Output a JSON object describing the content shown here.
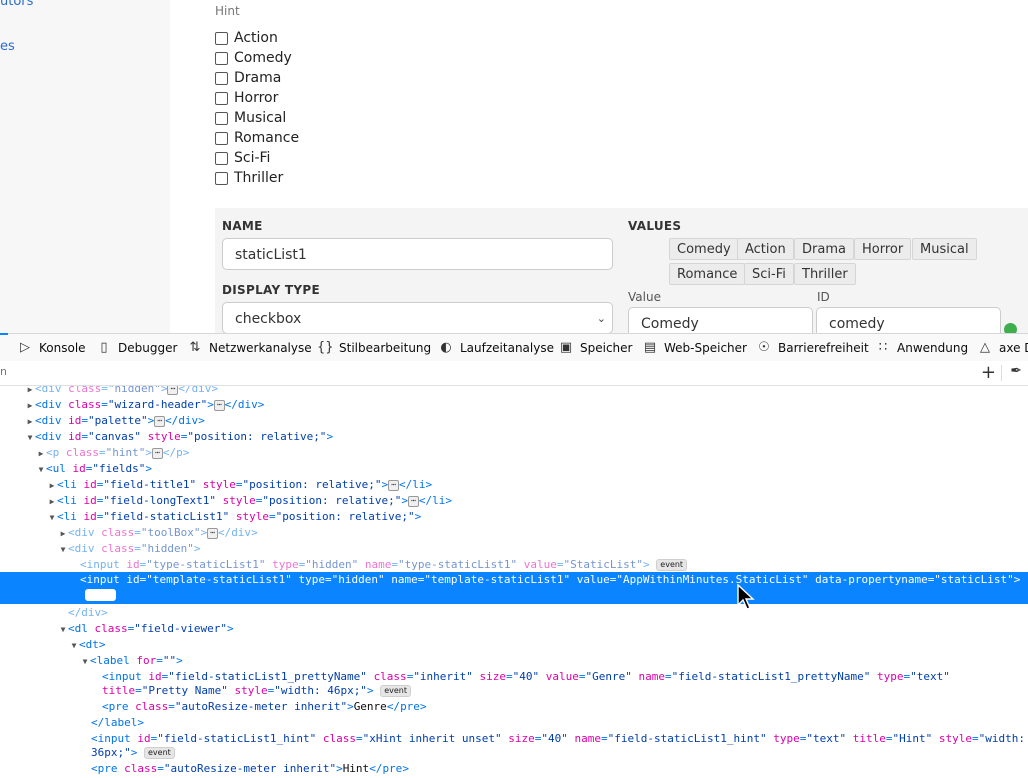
{
  "page": {
    "nav_links": [
      "utors",
      "es"
    ],
    "hint_label": "Hint",
    "checkbox_options": [
      "Action",
      "Comedy",
      "Drama",
      "Horror",
      "Musical",
      "Romance",
      "Sci-Fi",
      "Thriller"
    ],
    "panel": {
      "name_label": "NAME",
      "name_value": "staticList1",
      "display_type_label": "DISPLAY TYPE",
      "display_type_value": "checkbox",
      "values_label": "VALUES",
      "value_chips": [
        "Comedy",
        "Action",
        "Drama",
        "Horror",
        "Musical",
        "Romance",
        "Sci-Fi",
        "Thriller"
      ],
      "value_label": "Value",
      "id_label": "ID",
      "value_field": "Comedy",
      "id_field": "comedy"
    }
  },
  "devtools": {
    "tabs": [
      {
        "icon": "console-icon",
        "label": "Konsole"
      },
      {
        "icon": "debugger-icon",
        "label": "Debugger"
      },
      {
        "icon": "network-icon",
        "label": "Netzwerkanalyse"
      },
      {
        "icon": "style-editor-icon",
        "label": "Stilbearbeitung"
      },
      {
        "icon": "performance-icon",
        "label": "Laufzeitanalyse"
      },
      {
        "icon": "memory-icon",
        "label": "Speicher"
      },
      {
        "icon": "storage-icon",
        "label": "Web-Speicher"
      },
      {
        "icon": "accessibility-icon",
        "label": "Barrierefreiheit"
      },
      {
        "icon": "application-icon",
        "label": "Anwendung"
      },
      {
        "icon": "axe-icon",
        "label": "axe D"
      }
    ],
    "search_placeholder": "n",
    "accent_color": "#0a84ff"
  }
}
